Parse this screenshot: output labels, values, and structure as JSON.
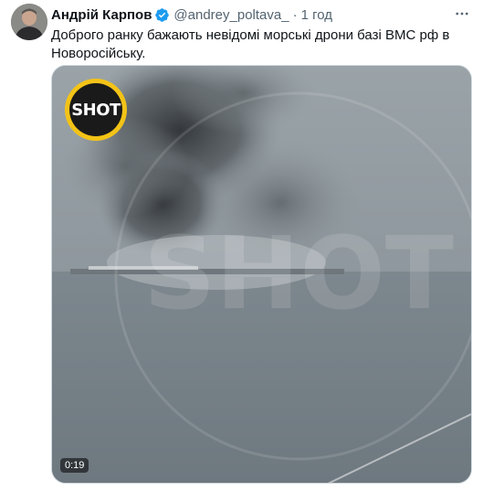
{
  "tweet": {
    "display_name": "Андрій Карпов",
    "handle": "@andrey_poltava_",
    "separator": "·",
    "time": "1 год",
    "text": "Доброго ранку бажають невідомі морські дрони базі ВМС рф в Новоросійську.",
    "verified": true,
    "more_icon": "ellipsis-icon"
  },
  "media": {
    "badge_text": "SHOT",
    "watermark_text": "SHOT",
    "duration": "0:19",
    "colors": {
      "badge": "#f3c317",
      "sea": "#7c878f",
      "smoke": "#3f4347"
    }
  },
  "colors": {
    "verified": "#1d9bf0",
    "secondary_text": "#536471",
    "primary_text": "#0f1419"
  }
}
